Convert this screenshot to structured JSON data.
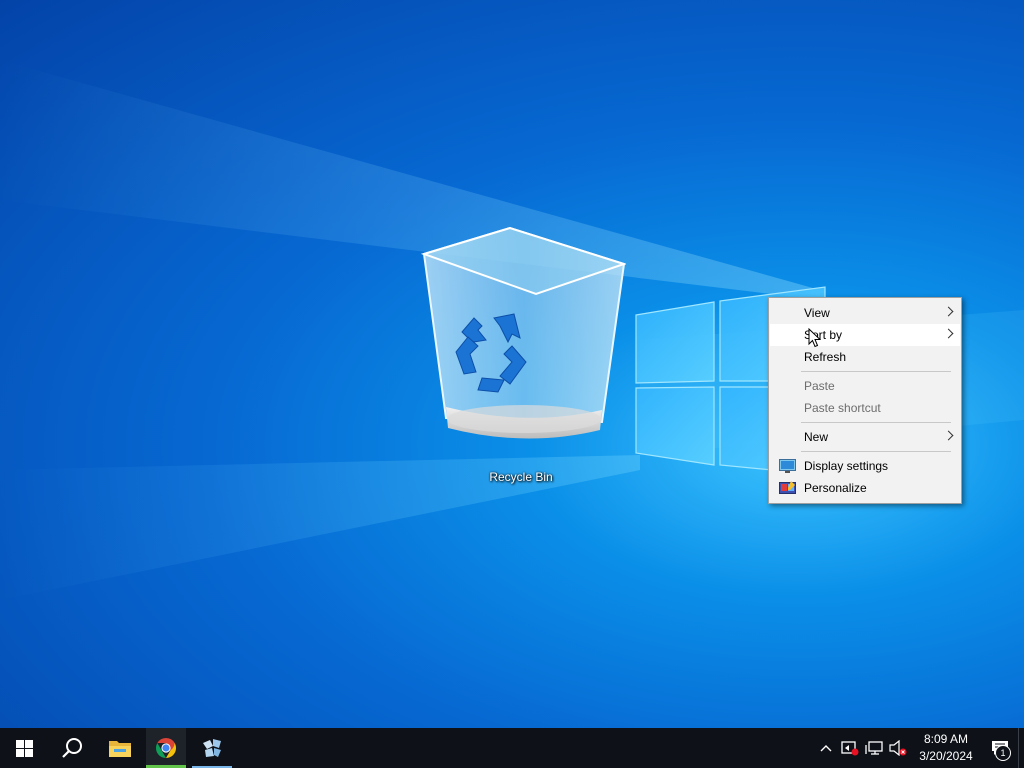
{
  "desktop": {
    "icons": [
      {
        "label": "Recycle Bin"
      }
    ]
  },
  "context_menu": {
    "items": [
      {
        "label": "View",
        "submenu": true,
        "disabled": false
      },
      {
        "label": "Sort by",
        "submenu": true,
        "disabled": false,
        "highlighted": true
      },
      {
        "label": "Refresh",
        "submenu": false,
        "disabled": false
      },
      {
        "label": "Paste",
        "submenu": false,
        "disabled": true
      },
      {
        "label": "Paste shortcut",
        "submenu": false,
        "disabled": true
      },
      {
        "label": "New",
        "submenu": true,
        "disabled": false
      },
      {
        "label": "Display settings",
        "submenu": false,
        "disabled": false,
        "icon": "display-settings-icon"
      },
      {
        "label": "Personalize",
        "submenu": false,
        "disabled": false,
        "icon": "personalize-icon"
      }
    ]
  },
  "taskbar": {
    "pinned": [
      {
        "icon": "start-windows-icon"
      },
      {
        "icon": "search-icon"
      },
      {
        "icon": "file-explorer-icon"
      },
      {
        "icon": "chrome-icon",
        "active": true
      },
      {
        "icon": "app-game-controller-icon",
        "running": true
      }
    ],
    "tray": {
      "icons": [
        "chevron-up-icon",
        "tray-app-icon",
        "network-icon",
        "volume-muted-icon"
      ],
      "time": "8:09 AM",
      "date": "3/20/2024",
      "notification_count": "1"
    }
  },
  "colors": {
    "accent": "#0078d7",
    "taskbar": "#0e1117",
    "menu_bg": "#f2f2f2",
    "chrome_indicator": "#63c44b"
  }
}
